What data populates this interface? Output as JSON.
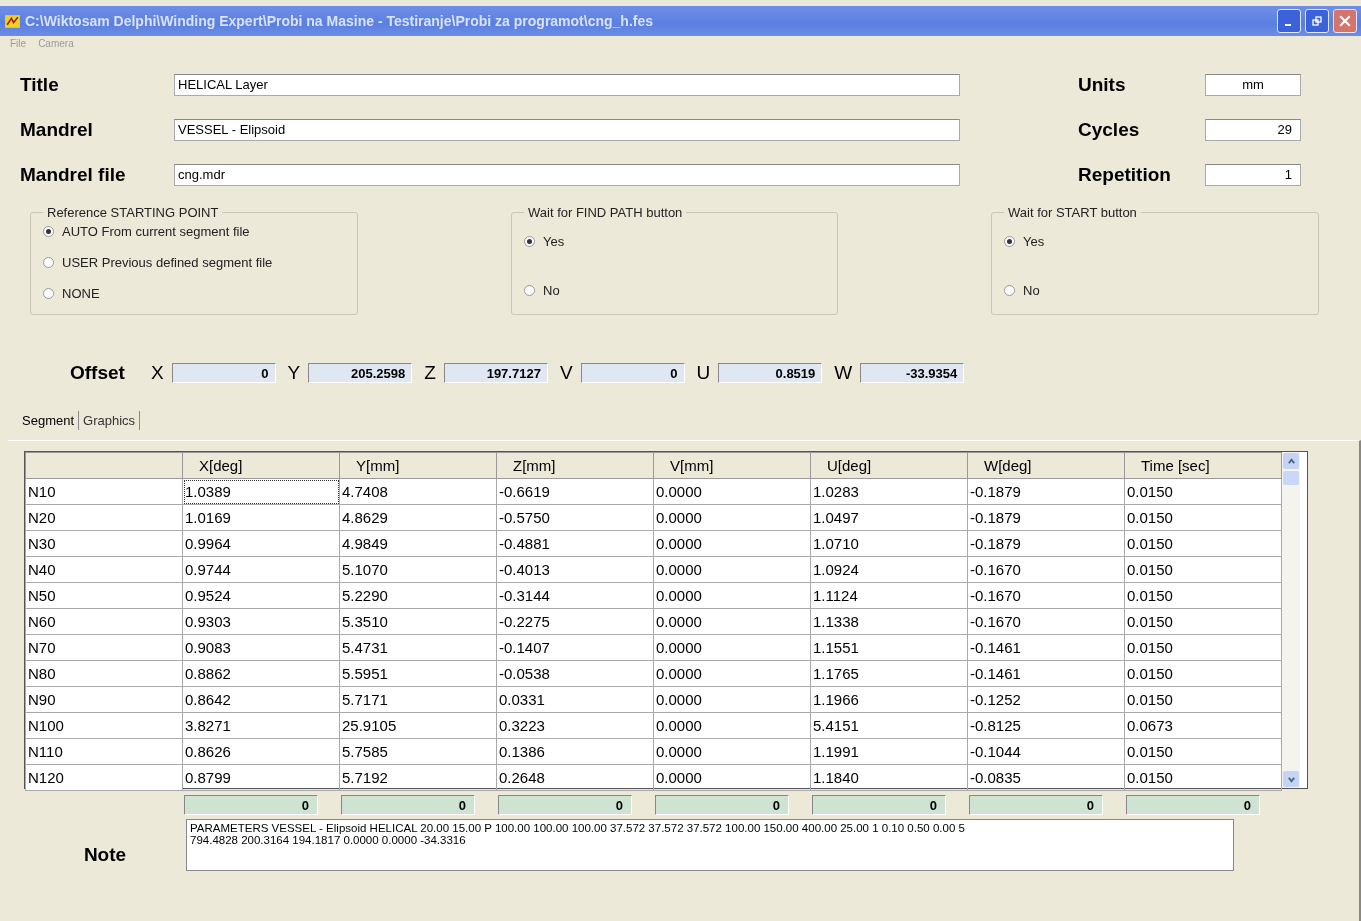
{
  "window": {
    "title": "C:\\Wiktosam Delphi\\Winding Expert\\Probi na Masine - Testiranje\\Probi za programot\\cng_h.fes"
  },
  "menu": [
    "File",
    "Camera"
  ],
  "fields_left": [
    {
      "label": "Title",
      "value": "HELICAL Layer"
    },
    {
      "label": "Mandrel",
      "value": "VESSEL - Elipsoid"
    },
    {
      "label": "Mandrel file",
      "value": "cng.mdr"
    }
  ],
  "fields_right": [
    {
      "label": "Units",
      "value": "mm"
    },
    {
      "label": "Cycles",
      "value": "29"
    },
    {
      "label": "Repetition",
      "value": "1"
    }
  ],
  "groups": [
    {
      "title": "Reference STARTING POINT",
      "options": [
        {
          "label": "AUTO From current segment file",
          "selected": true
        },
        {
          "label": "USER Previous defined segment file",
          "selected": false
        },
        {
          "label": "NONE",
          "selected": false
        }
      ]
    },
    {
      "title": "Wait for FIND PATH button",
      "options": [
        {
          "label": "Yes",
          "selected": true
        },
        {
          "label": "No",
          "selected": false
        }
      ]
    },
    {
      "title": "Wait for START button",
      "options": [
        {
          "label": "Yes",
          "selected": true
        },
        {
          "label": "No",
          "selected": false
        }
      ]
    }
  ],
  "offset": {
    "label": "Offset",
    "axes": [
      {
        "label": "X",
        "value": "0"
      },
      {
        "label": "Y",
        "value": "205.2598"
      },
      {
        "label": "Z",
        "value": "197.7127"
      },
      {
        "label": "V",
        "value": "0"
      },
      {
        "label": "U",
        "value": "0.8519"
      },
      {
        "label": "W",
        "value": "-33.9354"
      }
    ]
  },
  "tabs": [
    {
      "label": "Segment",
      "selected": true
    },
    {
      "label": "Graphics",
      "selected": false
    }
  ],
  "table": {
    "columns": [
      "",
      "X[deg]",
      "Y[mm]",
      "Z[mm]",
      "V[mm]",
      "U[deg]",
      "W[deg]",
      "Time [sec]"
    ],
    "rows": [
      [
        "N10",
        "1.0389",
        "4.7408",
        "-0.6619",
        "0.0000",
        "1.0283",
        "-0.1879",
        "0.0150"
      ],
      [
        "N20",
        "1.0169",
        "4.8629",
        "-0.5750",
        "0.0000",
        "1.0497",
        "-0.1879",
        "0.0150"
      ],
      [
        "N30",
        "0.9964",
        "4.9849",
        "-0.4881",
        "0.0000",
        "1.0710",
        "-0.1879",
        "0.0150"
      ],
      [
        "N40",
        "0.9744",
        "5.1070",
        "-0.4013",
        "0.0000",
        "1.0924",
        "-0.1670",
        "0.0150"
      ],
      [
        "N50",
        "0.9524",
        "5.2290",
        "-0.3144",
        "0.0000",
        "1.1124",
        "-0.1670",
        "0.0150"
      ],
      [
        "N60",
        "0.9303",
        "5.3510",
        "-0.2275",
        "0.0000",
        "1.1338",
        "-0.1670",
        "0.0150"
      ],
      [
        "N70",
        "0.9083",
        "5.4731",
        "-0.1407",
        "0.0000",
        "1.1551",
        "-0.1461",
        "0.0150"
      ],
      [
        "N80",
        "0.8862",
        "5.5951",
        "-0.0538",
        "0.0000",
        "1.1765",
        "-0.1461",
        "0.0150"
      ],
      [
        "N90",
        "0.8642",
        "5.7171",
        "0.0331",
        "0.0000",
        "1.1966",
        "-0.1252",
        "0.0150"
      ],
      [
        "N100",
        "3.8271",
        "25.9105",
        "0.3223",
        "0.0000",
        "5.4151",
        "-0.8125",
        "0.0673"
      ],
      [
        "N110",
        "0.8626",
        "5.7585",
        "0.1386",
        "0.0000",
        "1.1991",
        "-0.1044",
        "0.0150"
      ],
      [
        "N120",
        "0.8799",
        "5.7192",
        "0.2648",
        "0.0000",
        "1.1840",
        "-0.0835",
        "0.0150"
      ]
    ]
  },
  "totals": [
    "0",
    "0",
    "0",
    "0",
    "0",
    "0",
    "0"
  ],
  "note": {
    "label": "Note",
    "lines": [
      "PARAMETERS VESSEL - Elipsoid HELICAL 20.00 15.00 P 100.00 100.00 100.00 37.572 37.572 37.572 100.00 150.00 400.00 25.00  1 0.10 0.50 0.00 5",
      "794.4828 200.3164 194.1817 0.0000 0.0000 -34.3316"
    ]
  }
}
